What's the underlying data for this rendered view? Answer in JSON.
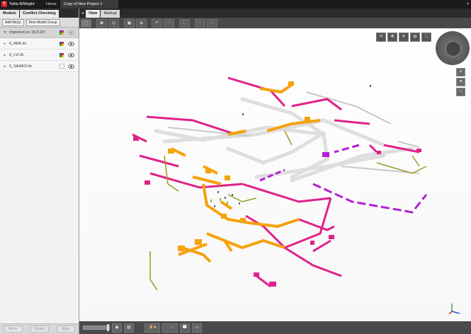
{
  "titlebar": {
    "app_name": "Tekla BIMsight",
    "tabs": [
      "Home",
      "Copy of New Project 1"
    ],
    "window_button": "▾"
  },
  "left_panel": {
    "tabs": {
      "models": "Models",
      "conflict": "Conflict Checking"
    },
    "buttons": {
      "add_files": "Add file(s)",
      "new_group": "New Model Group"
    },
    "group": {
      "label": "Imported on 18.9.20!"
    },
    "models": [
      {
        "name": "0_ARK.ifc",
        "color": "multi"
      },
      {
        "name": "0_LVI.ifc",
        "color": "multi"
      },
      {
        "name": "0_SAHKO.ifc",
        "color": "empty"
      }
    ],
    "bottom_buttons": {
      "move": "Move",
      "rotate": "Rotate",
      "align": "Align"
    }
  },
  "view": {
    "tabs": {
      "view": "View",
      "markup": "Markup"
    },
    "collapse_icon": "◂"
  },
  "colors": {
    "magenta": "#e0218a",
    "orange": "#f5a20a",
    "olive": "#9a9a1e",
    "purple": "#b21fd6",
    "gray": "#d8d8d8",
    "toolbar": "#4a4a4a"
  }
}
